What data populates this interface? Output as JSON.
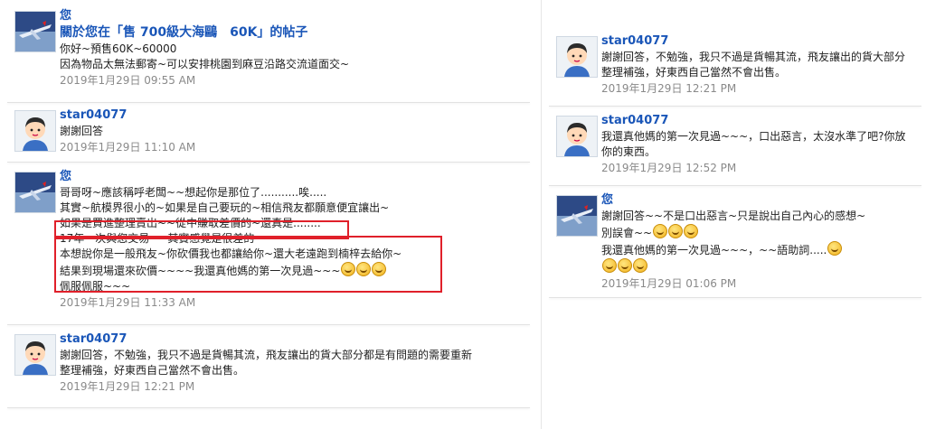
{
  "left": {
    "posts": [
      {
        "name": "您",
        "avatar": "airplane-avatar",
        "title": "關於您在「售 700級大海鷗　60K」的帖子",
        "lines": [
          "你好~預售60K~60000",
          "因為物品太無法郵寄~可以安排桃園到麻豆沿路交流道面交~"
        ],
        "time": "2019年1月29日 09:55 AM"
      },
      {
        "name": "star04077",
        "avatar": "boy-avatar",
        "lines": [
          "謝謝回答"
        ],
        "time": "2019年1月29日 11:10 AM"
      },
      {
        "name": "您",
        "avatar": "airplane-avatar",
        "lines": [
          "哥哥呀~應該稱呼老闆~~想起你是那位了...........唉.....",
          "其實~航模界很小的~如果是自己要玩的~相信飛友都願意便宜讓出~",
          "如果是買進整理賣出~~從中賺取差價的~還真是........",
          "17年一次與您交易~~其實感覺是很差的~~",
          "本想說你是一般飛友~你砍價我也都讓給你~還大老遠跑到楠梓去給你~",
          "結果到現場還來砍價~~~~我還真他媽的第一次見過~~~",
          "佩服佩服~~~"
        ],
        "time": "2019年1月29日 11:33 AM"
      },
      {
        "name": "star04077",
        "avatar": "boy-avatar",
        "lines": [
          "謝謝回答，不勉強，我只不過是貨暢其流，飛友讓出的貨大部分都是有問題的需要重新",
          "整理補強，好東西自己當然不會出售。"
        ],
        "time": "2019年1月29日 12:21 PM"
      }
    ]
  },
  "right": {
    "posts": [
      {
        "name": "star04077",
        "avatar": "boy-avatar",
        "lines": [
          "謝謝回答，不勉強，我只不過是貨暢其流，飛友讓出的貨大部分",
          "整理補強，好東西自己當然不會出售。"
        ],
        "time": "2019年1月29日 12:21 PM"
      },
      {
        "name": "star04077",
        "avatar": "boy-avatar",
        "lines": [
          "我還真他媽的第一次見過~~~，口出惡言，太沒水準了吧?你放",
          "你的東西。"
        ],
        "time": "2019年1月29日 12:52 PM"
      },
      {
        "name": "您",
        "avatar": "airplane-avatar",
        "lines": [
          "謝謝回答~~不是口出惡言~只是說出自己內心的感想~",
          "別誤會~~",
          "我還真他媽的第一次見過~~~，~~語助詞....."
        ],
        "time": "2019年1月29日 01:06 PM"
      }
    ]
  },
  "colors": {
    "link": "#1a56b8",
    "timestamp": "#8a8a8a",
    "highlight_box": "#e0202a"
  }
}
